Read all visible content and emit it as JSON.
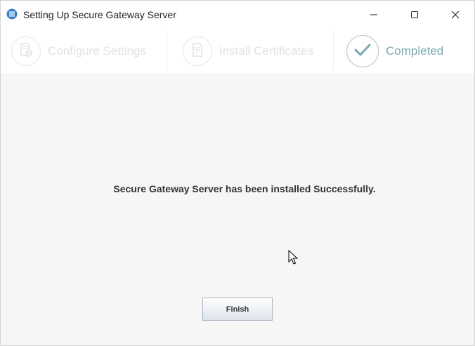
{
  "window": {
    "title": "Setting Up Secure Gateway Server",
    "icon": "app-logo-icon",
    "controls": {
      "minimize": "minimize-icon",
      "maximize": "maximize-icon",
      "close": "close-icon"
    }
  },
  "steps": [
    {
      "label": "Configure Settings",
      "icon": "server-settings-icon",
      "state": "inactive"
    },
    {
      "label": "Install Certificates",
      "icon": "certificate-icon",
      "state": "inactive"
    },
    {
      "label": "Completed",
      "icon": "checkmark-icon",
      "state": "active"
    }
  ],
  "main": {
    "message": "Secure Gateway Server has been installed Successfully.",
    "finish_label": "Finish"
  },
  "colors": {
    "accent": "#7aa9b2",
    "inactive": "#e2e2e2",
    "app_icon": "#3b82c4"
  }
}
